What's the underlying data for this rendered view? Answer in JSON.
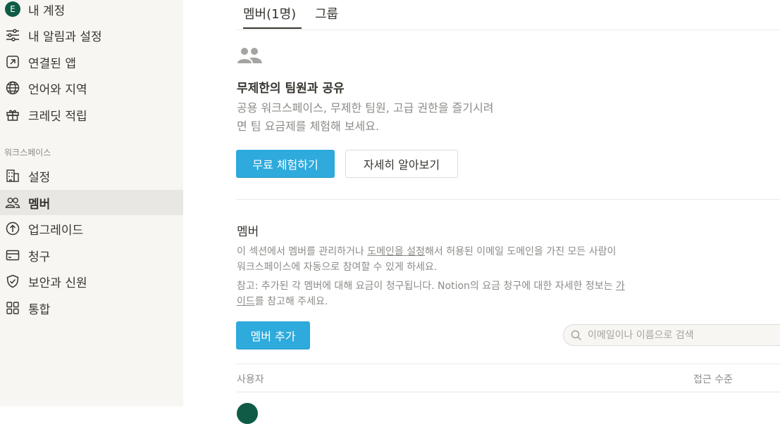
{
  "sidebar": {
    "items": [
      {
        "label": "내 계정",
        "icon": "avatar-e",
        "avatar_letter": "E"
      },
      {
        "label": "내 알림과 설정",
        "icon": "sliders-icon"
      },
      {
        "label": "연결된 앱",
        "icon": "external-link-icon"
      },
      {
        "label": "언어와 지역",
        "icon": "globe-icon"
      },
      {
        "label": "크레딧 적립",
        "icon": "gift-icon"
      }
    ],
    "section_label": "워크스페이스",
    "workspace_items": [
      {
        "label": "설정",
        "icon": "building-icon"
      },
      {
        "label": "멤버",
        "icon": "people-icon",
        "active": true
      },
      {
        "label": "업그레이드",
        "icon": "arrow-up-circle-icon"
      },
      {
        "label": "청구",
        "icon": "credit-card-icon"
      },
      {
        "label": "보안과 신원",
        "icon": "shield-icon"
      },
      {
        "label": "통합",
        "icon": "grid-icon"
      }
    ]
  },
  "tabs": [
    {
      "label": "멤버(1명)",
      "active": true
    },
    {
      "label": "그룹",
      "active": false
    }
  ],
  "promo": {
    "icon": "people-icon",
    "title": "무제한의 팀원과 공유",
    "desc_line1": "공용 워크스페이스, 무제한 팀원, 고급 권한을 즐기시려",
    "desc_line2": "면 팀 요금제를 체험해 보세요.",
    "trial_button": "무료 체험하기",
    "learn_button": "자세히 알아보기"
  },
  "members": {
    "heading": "멤버",
    "p1_a": "이 섹션에서 멤버를 관리하거나 ",
    "p1_link": "도메인을 설정",
    "p1_b": "해서 허용된 이메일 도메인을 가진 모든 사람이",
    "p1_c": "워크스페이스에 자동으로 참여할 수 있게 하세요.",
    "p2_a": "참고: 추가된 각 멤버에 대해 요금이 청구됩니다. Notion의 요금 청구에 대한 자세한 정보는 ",
    "p2_link1": "가",
    "p2_link2": "이드",
    "p2_b": "를 참고해 주세요.",
    "add_button": "멤버 추가",
    "search_placeholder": "이메일이나 이름으로 검색",
    "col_user": "사용자",
    "col_access": "접근 수준"
  },
  "colors": {
    "accent": "#2eaadc",
    "sidebar_bg": "#f7f6f3",
    "avatar": "#0f5b45",
    "muted_text": "#8c8b88"
  }
}
